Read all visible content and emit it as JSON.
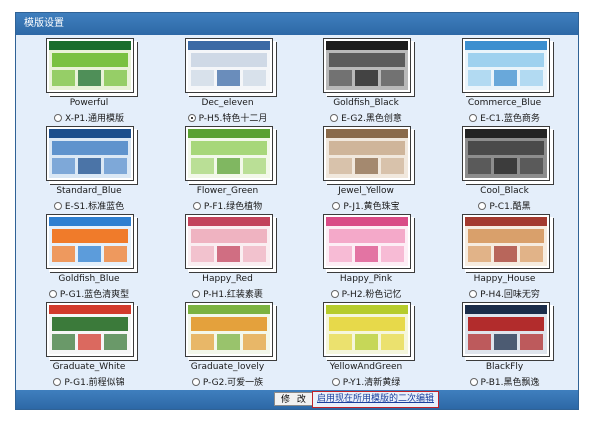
{
  "panel": {
    "title": "模版设置"
  },
  "footer": {
    "edit_label": "修 改",
    "link_label": "启用现在所用模版的二次编辑"
  },
  "templates": [
    {
      "name": "Powerful",
      "option": "X-P1.通用模版",
      "selected": false,
      "colors": [
        "#1b6d2e",
        "#7ac142",
        "#e9f2d8"
      ]
    },
    {
      "name": "Dec_eleven",
      "option": "P-H5.特色十二月",
      "selected": true,
      "colors": [
        "#3c6aa5",
        "#cfd9e6",
        "#f4f6f9"
      ]
    },
    {
      "name": "Goldfish_Black",
      "option": "E-G2.黑色创意",
      "selected": false,
      "colors": [
        "#1c1c1c",
        "#5b5b5b",
        "#b9b9b9"
      ]
    },
    {
      "name": "Commerce_Blue",
      "option": "E-C1.蓝色商务",
      "selected": false,
      "colors": [
        "#3d8fcf",
        "#9fd1ef",
        "#eaf4fb"
      ]
    },
    {
      "name": "Standard_Blue",
      "option": "E-S1.标准蓝色",
      "selected": false,
      "colors": [
        "#1b4e8c",
        "#5f93cd",
        "#dbe8f5"
      ]
    },
    {
      "name": "Flower_Green",
      "option": "P-F1.绿色植物",
      "selected": false,
      "colors": [
        "#5aa133",
        "#a7d77a",
        "#f2f8e9"
      ]
    },
    {
      "name": "Jewel_Yellow",
      "option": "P-J1.黄色珠宝",
      "selected": false,
      "colors": [
        "#8a6a4a",
        "#cfb59a",
        "#f1e8dd"
      ]
    },
    {
      "name": "Cool_Black",
      "option": "P-C1.酷黑",
      "selected": false,
      "colors": [
        "#222222",
        "#4a4a4a",
        "#8d8d8d"
      ]
    },
    {
      "name": "Goldfish_Blue",
      "option": "P-G1.蓝色清爽型",
      "selected": false,
      "colors": [
        "#2e7fd0",
        "#f07b2a",
        "#e6f1fb"
      ]
    },
    {
      "name": "Happy_Red",
      "option": "P-H1.红装素裹",
      "selected": false,
      "colors": [
        "#c2435c",
        "#efb3c1",
        "#faeef1"
      ]
    },
    {
      "name": "Happy_Pink",
      "option": "P-H2.粉色记忆",
      "selected": false,
      "colors": [
        "#d94b87",
        "#f4a9c9",
        "#fdeef5"
      ]
    },
    {
      "name": "Happy_House",
      "option": "P-H4.回味无穷",
      "selected": false,
      "colors": [
        "#a33a2f",
        "#d9a06b",
        "#f6ece0"
      ]
    },
    {
      "name": "Graduate_White",
      "option": "P-G1.前程似锦",
      "selected": false,
      "colors": [
        "#d23a2c",
        "#3b7a3a",
        "#f6f6f6"
      ]
    },
    {
      "name": "Graduate_lovely",
      "option": "P-G2.可爱一族",
      "selected": false,
      "colors": [
        "#7bb241",
        "#e4a13c",
        "#f3f7ea"
      ]
    },
    {
      "name": "YellowAndGreen",
      "option": "P-Y1.清新黄绿",
      "selected": false,
      "colors": [
        "#b6cc2c",
        "#e7d94a",
        "#f5f6dc"
      ]
    },
    {
      "name": "BlackFly",
      "option": "P-B1.黑色飘逸",
      "selected": false,
      "colors": [
        "#1b2d4a",
        "#b22c2c",
        "#dfe4ec"
      ]
    }
  ]
}
